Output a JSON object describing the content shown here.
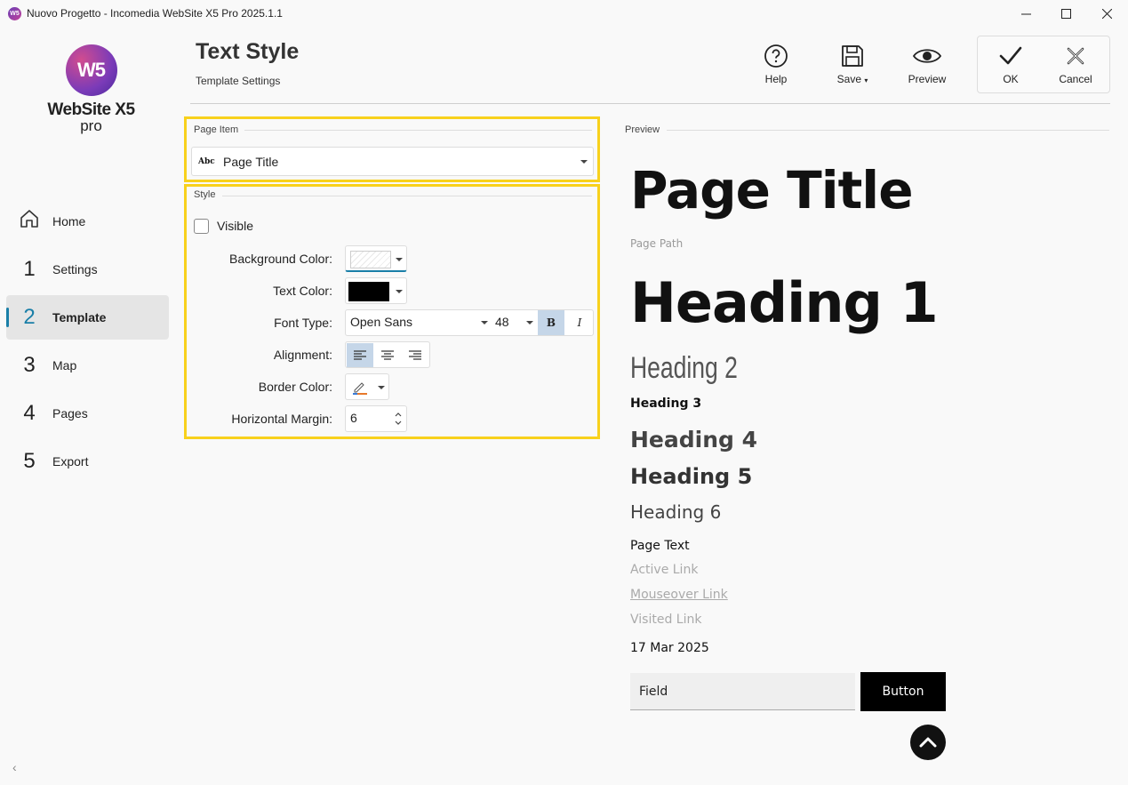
{
  "window": {
    "title": "Nuovo Progetto - Incomedia WebSite X5 Pro 2025.1.1"
  },
  "logo": {
    "badge": "W5",
    "name": "WebSite X5",
    "edition": "pro"
  },
  "nav": {
    "items": [
      {
        "num": "",
        "label": "Home"
      },
      {
        "num": "1",
        "label": "Settings"
      },
      {
        "num": "2",
        "label": "Template"
      },
      {
        "num": "3",
        "label": "Map"
      },
      {
        "num": "4",
        "label": "Pages"
      },
      {
        "num": "5",
        "label": "Export"
      }
    ]
  },
  "header": {
    "title": "Text Style",
    "subtitle": "Template Settings"
  },
  "toolbar": {
    "help": "Help",
    "save": "Save",
    "preview": "Preview",
    "ok": "OK",
    "cancel": "Cancel"
  },
  "page_item": {
    "group": "Page Item",
    "selected": "Page Title",
    "icon_text": "Abc"
  },
  "style": {
    "group": "Style",
    "visible_label": "Visible",
    "visible": false,
    "bg_color_label": "Background Color:",
    "text_color_label": "Text Color:",
    "text_color": "#000000",
    "font_type_label": "Font Type:",
    "font_name": "Open Sans",
    "font_size": "48",
    "bold": "B",
    "italic": "I",
    "alignment_label": "Alignment:",
    "alignment": "left",
    "border_color_label": "Border Color:",
    "h_margin_label": "Horizontal Margin:",
    "h_margin": "6"
  },
  "preview": {
    "group": "Preview",
    "page_title": "Page Title",
    "page_path": "Page Path",
    "h1": "Heading 1",
    "h2": "Heading 2",
    "h3": "Heading 3",
    "h4": "Heading 4",
    "h5": "Heading 5",
    "h6": "Heading 6",
    "page_text": "Page Text",
    "active_link": "Active Link",
    "mouseover_link": "Mouseover Link",
    "visited_link": "Visited Link",
    "date": "17 Mar 2025",
    "field": "Field",
    "button": "Button"
  },
  "colors": {
    "accent": "#1a7fa8",
    "highlight": "#f8d11c",
    "toggle_on": "#c5d6e8"
  }
}
